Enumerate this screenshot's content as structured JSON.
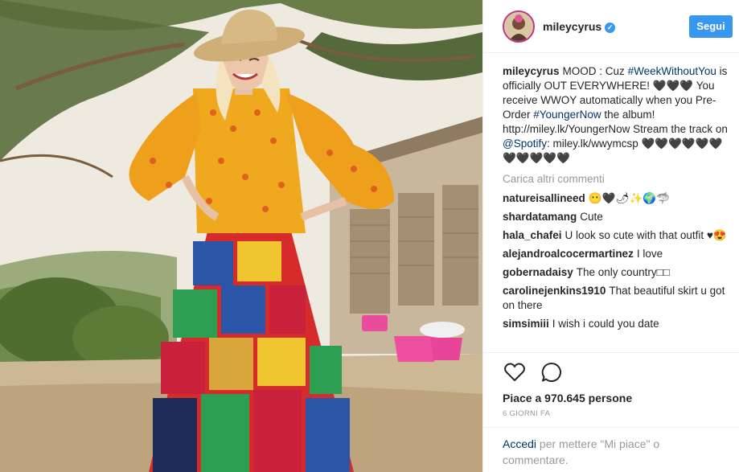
{
  "post": {
    "author": "mileycyrus",
    "follow_label": "Segui",
    "caption": {
      "username": "mileycyrus",
      "text_1": "MOOD : Cuz ",
      "tag_1": "#WeekWithoutYou",
      "text_2": " is officially OUT EVERYWHERE! 🖤🖤🖤 You receive WWOY automatically when you Pre-Order ",
      "tag_2": "#YoungerNow",
      "text_3": " the album! http://miley.lk/YoungerNow Stream the track on ",
      "tag_3": "@Spotify",
      "text_4": ": miley.lk/wwymcsp 🖤🖤🖤🖤🖤🖤🖤🖤🖤🖤🖤"
    },
    "load_more_label": "Carica altri commenti",
    "comments": [
      {
        "user": "natureisallineed",
        "text": "😶🖤🌶✨🌍🦈"
      },
      {
        "user": "shardatamang",
        "text": "Cute"
      },
      {
        "user": "hala_chafei",
        "text": "U look so cute with that outfit ♥😍"
      },
      {
        "user": "alejandroalcocermartinez",
        "text": "I love"
      },
      {
        "user": "gobernadaisy",
        "text": "The only country□□"
      },
      {
        "user": "carolinejenkins1910",
        "text": "That beautiful skirt u got on there"
      },
      {
        "user": "simsimiii",
        "text": "I wish i could you date"
      }
    ],
    "likes_text": "Piace a 970.645 persone",
    "time_ago": "6 GIORNI FA",
    "login_link": "Accedi",
    "login_text": " per mettere \"Mi piace\" o commentare."
  },
  "colors": {
    "accent": "#3897f0",
    "link": "#003569",
    "muted": "#999999"
  },
  "icons": {
    "like": "heart-icon",
    "comment": "comment-icon",
    "verified": "verified-badge-icon"
  }
}
